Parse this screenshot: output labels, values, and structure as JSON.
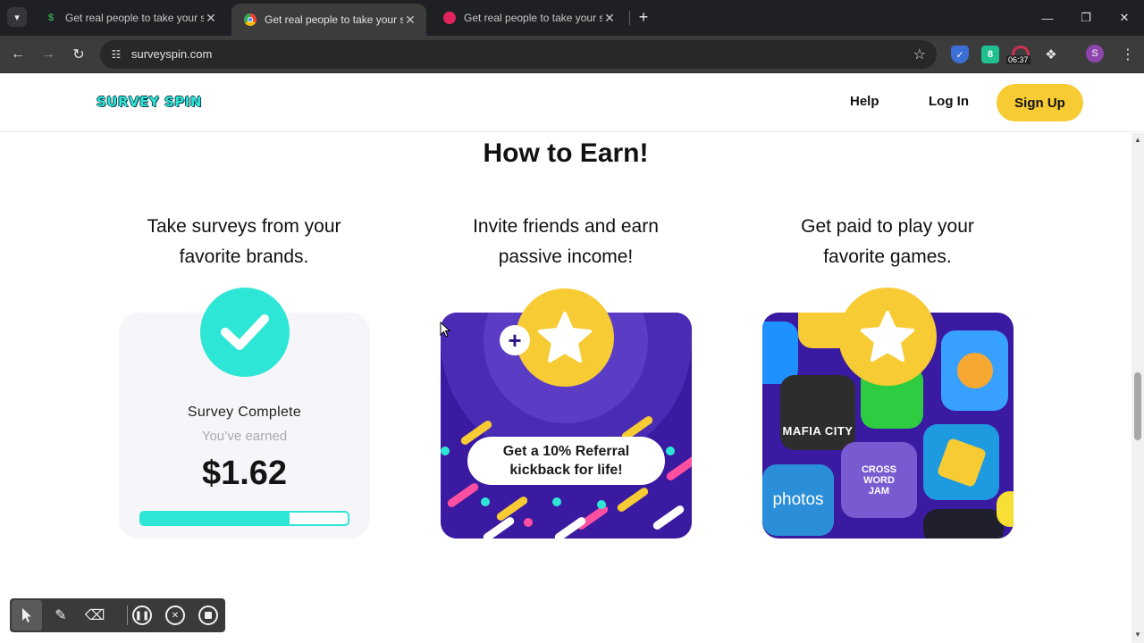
{
  "browser": {
    "tabs": [
      {
        "title": "Get real people to take your su",
        "favicon": "dollar-icon",
        "active": false
      },
      {
        "title": "Get real people to take your su",
        "favicon": "chrome-icon",
        "active": true
      },
      {
        "title": "Get real people to take your su",
        "favicon": "circle-app-icon",
        "active": false
      }
    ],
    "url": "surveyspin.com",
    "extension_time": "06:37",
    "extension_count": "8",
    "profile_initial": "S"
  },
  "site": {
    "logo": "SURVEY SPIN",
    "nav": {
      "help": "Help",
      "login": "Log In",
      "signup": "Sign Up"
    },
    "accent_colors": {
      "teal": "#2ee6d6",
      "yellow": "#f7cb33",
      "purple": "#3a1aa0"
    }
  },
  "section": {
    "title": "How to Earn!",
    "columns": [
      {
        "title_line1": "Take surveys from your",
        "title_line2": "favorite brands."
      },
      {
        "title_line1": "Invite friends and earn",
        "title_line2": "passive income!"
      },
      {
        "title_line1": "Get paid to play your",
        "title_line2": "favorite games."
      }
    ]
  },
  "survey_card": {
    "title": "Survey Complete",
    "subtitle": "You’ve earned",
    "amount": "$1.62",
    "progress": 0.72
  },
  "referral_card": {
    "line1": "Get a 10% Referral",
    "line2": "kickback for life!",
    "badge": "+"
  },
  "games_card": {
    "apps": [
      "MAFIA CITY",
      "photos",
      "CROSS",
      "WORD",
      "JAM"
    ]
  }
}
